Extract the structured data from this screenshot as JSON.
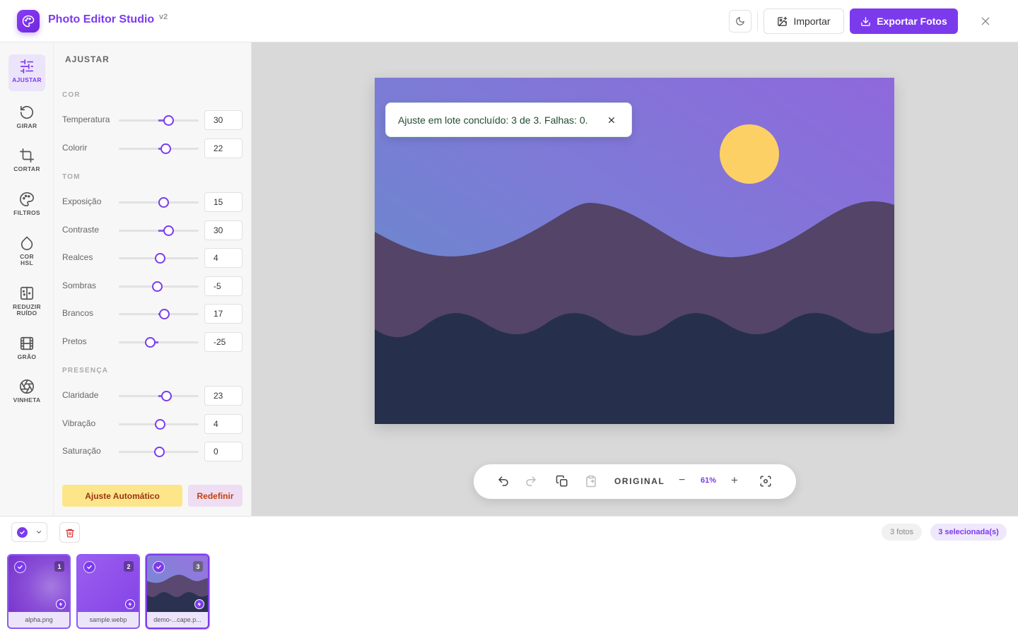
{
  "app": {
    "title": "Photo Editor Studio",
    "version": "v2",
    "import_label": "Importar",
    "export_label": "Exportar Fotos",
    "accent_color": "#7c3aed"
  },
  "rail": {
    "items": [
      {
        "label": "AJUSTAR",
        "icon": "sliders-icon",
        "active": true
      },
      {
        "label": "GIRAR",
        "icon": "rotate-icon"
      },
      {
        "label": "CORTAR",
        "icon": "crop-icon"
      },
      {
        "label": "FILTROS",
        "icon": "palette-icon"
      },
      {
        "label": "COR\nHSL",
        "icon": "droplet-icon"
      },
      {
        "label": "REDUZIR\nRUÍDO",
        "icon": "noise-icon"
      },
      {
        "label": "GRÃO",
        "icon": "film-icon"
      },
      {
        "label": "VINHETA",
        "icon": "aperture-icon"
      }
    ]
  },
  "panel": {
    "title": "AJUSTAR",
    "sections": {
      "cor": "COR",
      "tom": "TOM",
      "presenca": "PRESENÇA"
    },
    "sliders": [
      {
        "label": "Temperatura",
        "value": "30"
      },
      {
        "label": "Colorir",
        "value": "22"
      },
      {
        "label": "Exposição",
        "value": "15"
      },
      {
        "label": "Contraste",
        "value": "30"
      },
      {
        "label": "Realces",
        "value": "4"
      },
      {
        "label": "Sombras",
        "value": "-5"
      },
      {
        "label": "Brancos",
        "value": "17"
      },
      {
        "label": "Pretos",
        "value": "-25"
      },
      {
        "label": "Claridade",
        "value": "23"
      },
      {
        "label": "Vibração",
        "value": "4"
      },
      {
        "label": "Saturação",
        "value": "0"
      }
    ],
    "auto_label": "Ajuste Automático",
    "reset_label": "Redefinir"
  },
  "canvas": {
    "toast": "Ajuste em lote concluído: 3 de 3. Falhas: 0.",
    "original_label": "ORIGINAL",
    "zoom_minus": "−",
    "zoom": "61%",
    "zoom_plus": "+"
  },
  "filmstrip": {
    "count_label": "3 fotos",
    "selected_label": "3 selecionada(s)",
    "photos": [
      {
        "name": "alpha.png",
        "index": "1"
      },
      {
        "name": "sample.webp",
        "index": "2"
      },
      {
        "name": "demo-...cape.p...",
        "index": "3"
      }
    ]
  }
}
